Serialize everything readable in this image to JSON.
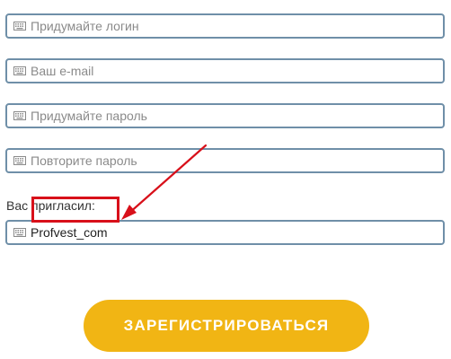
{
  "form": {
    "fields": [
      {
        "placeholder": "Придумайте логин",
        "value": "",
        "icon": "keyboard-icon"
      },
      {
        "placeholder": "Ваш e-mail",
        "value": "",
        "icon": "keyboard-icon"
      },
      {
        "placeholder": "Придумайте пароль",
        "value": "",
        "icon": "keyboard-icon"
      },
      {
        "placeholder": "Повторите пароль",
        "value": "",
        "icon": "keyboard-icon"
      }
    ],
    "referrer_label": "Вас пригласил:",
    "referrer": {
      "placeholder": "",
      "value": "Profvest_com",
      "icon": "keyboard-icon"
    },
    "submit_label": "ЗАРЕГИСТРИРОВАТЬСЯ"
  },
  "colors": {
    "field_border": "#6f8fa8",
    "annotation_red": "#d8101a",
    "button_yellow": "#f1b514",
    "button_text": "#ffffff"
  }
}
